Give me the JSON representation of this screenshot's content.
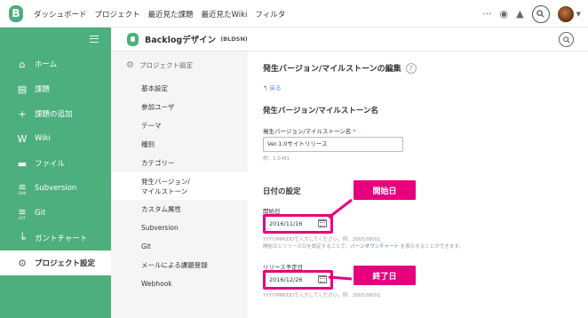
{
  "topbar": {
    "logo_letter": "B",
    "nav": [
      "ダッシュボード",
      "プロジェクト",
      "最近見た課題",
      "最近見たWiki",
      "フィルタ"
    ],
    "icons": [
      "more-icon",
      "watch-eye-icon",
      "bell-icon",
      "search-icon",
      "avatar"
    ]
  },
  "sidebar": {
    "items": [
      {
        "label": "ホーム",
        "icon": "home-icon",
        "glyph": "⌂"
      },
      {
        "label": "課題",
        "icon": "issues-list-icon",
        "glyph": "▤"
      },
      {
        "label": "課題の追加",
        "icon": "plus-icon",
        "glyph": "+"
      },
      {
        "label": "Wiki",
        "icon": "wiki-icon",
        "glyph": "W"
      },
      {
        "label": "ファイル",
        "icon": "folder-icon",
        "glyph": "▬"
      },
      {
        "label": "Subversion",
        "icon": "svn-icon",
        "glyph": "≡",
        "sub": "SVN"
      },
      {
        "label": "Git",
        "icon": "git-icon",
        "glyph": "≡",
        "sub": "GIT"
      },
      {
        "label": "ガントチャート",
        "icon": "gantt-chart-icon",
        "glyph": "╘"
      },
      {
        "label": "プロジェクト設定",
        "icon": "gear-icon",
        "glyph": "⚙"
      }
    ]
  },
  "project": {
    "name": "Backlogデザイン",
    "key": "(BLDSN)"
  },
  "settings_menu": {
    "title": "プロジェクト設定",
    "items": [
      "基本設定",
      "参加ユーザ",
      "テーマ",
      "種別",
      "カテゴリー",
      "発生バージョン/\nマイルストーン",
      "カスタム属性",
      "Subversion",
      "Git",
      "メールによる課題登録",
      "Webhook"
    ]
  },
  "main": {
    "page_title": "発生バージョン/マイルストーンの編集",
    "help": "?",
    "back_link": "↰ 戻る",
    "section_name": "発生バージョン/マイルストーン名",
    "name_label": "発生バージョン/マイルストーン名",
    "required_mark": "*",
    "name_value": "Ver.1.0サイトリリース",
    "name_hint": "例：1.0-M1",
    "section_date": "日付の設定",
    "start_label": "開始日",
    "start_value": "2016/11/16",
    "start_hint_1": "YYYY/MM/DDで入力してください。例：2005/06/01",
    "start_hint_2a": "開始日とリリース日を設定することで、",
    "start_hint_link": "バーンダウンチャート",
    "start_hint_2b": " を表示することができます。",
    "release_label": "リリース予定日",
    "release_value": "2016/12/26",
    "release_hint": "YYYY/MM/DDで入力してください。例：2005/06/01"
  },
  "callouts": {
    "start": "開始日",
    "end": "終了日",
    "color": "#e6007e"
  },
  "colors": {
    "brand_green": "#4caf7d",
    "link_blue": "#4a7fb5",
    "callout_pink": "#e6007e"
  }
}
